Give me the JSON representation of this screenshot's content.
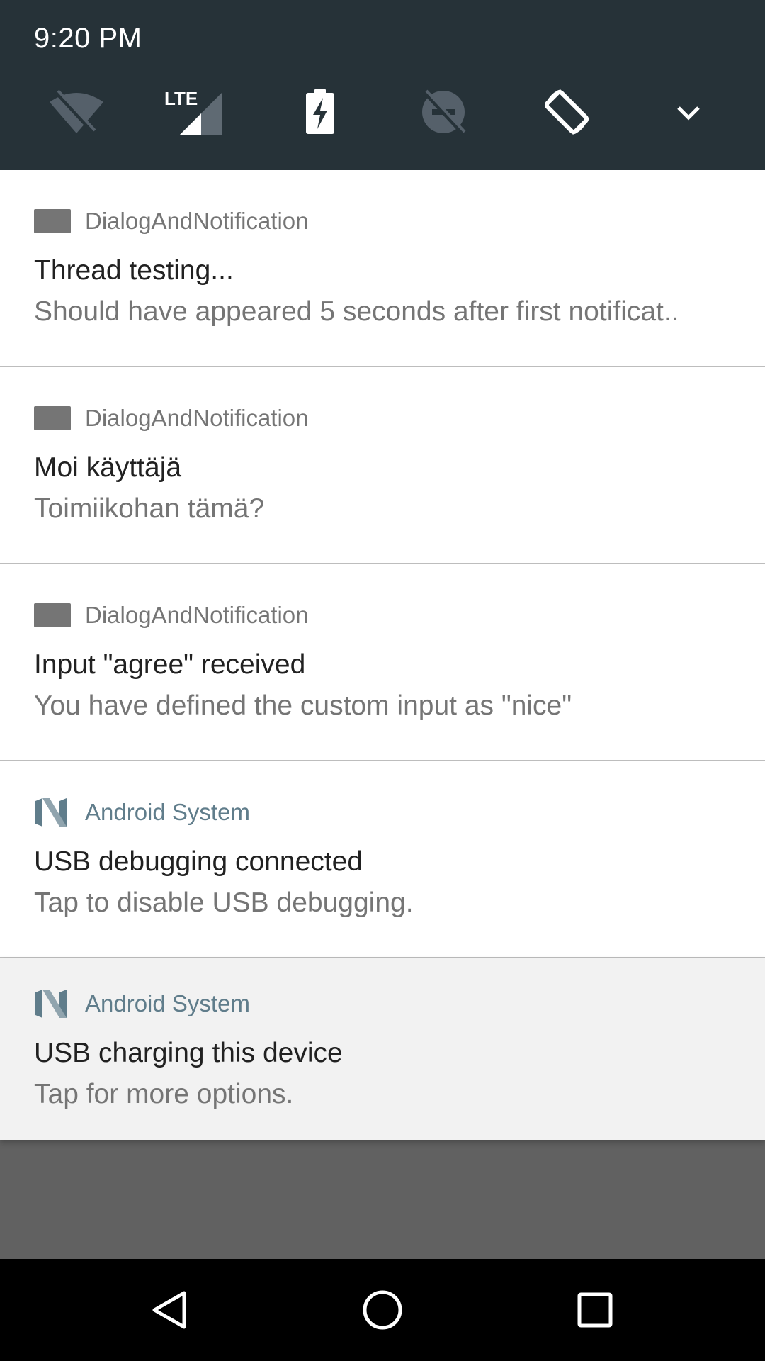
{
  "status_bar": {
    "time": "9:20 PM"
  },
  "quick_settings": {
    "tiles": [
      {
        "name": "wifi-off-icon"
      },
      {
        "name": "lte-signal-icon",
        "label": "LTE"
      },
      {
        "name": "battery-charging-icon"
      },
      {
        "name": "do-not-disturb-off-icon"
      },
      {
        "name": "auto-rotate-icon"
      },
      {
        "name": "expand-chevron-icon"
      }
    ]
  },
  "notifications": [
    {
      "app": "DialogAndNotification",
      "title": "Thread testing...",
      "text": "Should have appeared 5 seconds after first notificat.."
    },
    {
      "app": "DialogAndNotification",
      "title": "Moi käyttäjä",
      "text": "Toimiikohan tämä?"
    },
    {
      "app": "DialogAndNotification",
      "title": "Input \"agree\" received",
      "text": "You have defined the custom input as \"nice\""
    },
    {
      "app": "Android System",
      "title": "USB debugging connected",
      "text": "Tap to disable USB debugging."
    },
    {
      "app": "Android System",
      "title": "USB charging this device",
      "text": "Tap for more options."
    }
  ],
  "nav_bar": {
    "buttons": [
      "back-icon",
      "home-icon",
      "recents-icon"
    ]
  },
  "colors": {
    "header_bg": "#263238",
    "scrim": "#616161",
    "system_app_accent": "#607d8b"
  }
}
